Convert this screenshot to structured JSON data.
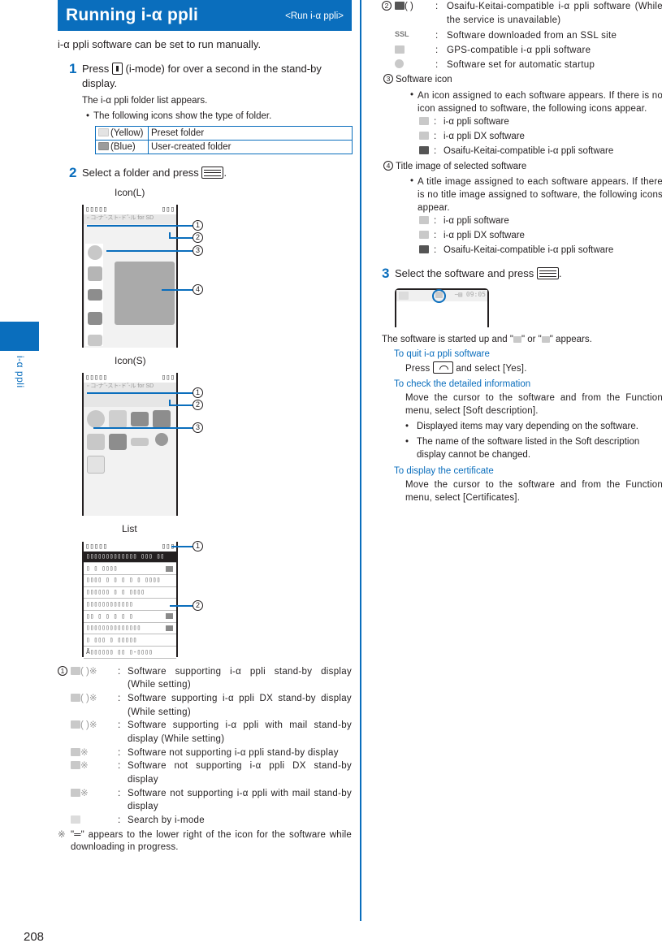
{
  "sidebar": {
    "section_label": "i-α ppli",
    "tab_color": "#0a6ebd"
  },
  "page_number": "208",
  "header": {
    "title": "Running i-α ppli",
    "subtitle": "<Run i-α ppli>"
  },
  "intro": "i-α ppli software can be set to run manually.",
  "step1": {
    "num": "1",
    "text_before": "Press",
    "key_icon": "i-mode-key",
    "text_after": "(i-mode) for over a second in the stand-by display.",
    "result": "The i-α ppli folder list appears.",
    "bullet": "The following icons show the type of folder.",
    "folder_table": [
      {
        "icon": "yellow-folder",
        "color_label": "(Yellow)",
        "desc": "Preset folder"
      },
      {
        "icon": "blue-folder",
        "color_label": "(Blue)",
        "desc": "User-created folder"
      }
    ]
  },
  "step2": {
    "num": "2",
    "text": "Select a folder and press",
    "key_icon": "menu-key",
    "screens": [
      {
        "label": "Icon(L)",
        "status_left": "▯▯▯▯▯",
        "status_right": "▯▯▯",
        "folder_bar": "▫ コ-ナ˝-スト-ド˝-ル for SD",
        "callouts": [
          "1",
          "2",
          "3",
          "4"
        ]
      },
      {
        "label": "Icon(S)",
        "status_left": "▯▯▯▯▯",
        "status_right": "▯▯▯",
        "folder_bar": "▫ コ-ナ˝-スト-ド˝-ル for SD",
        "callouts": [
          "1",
          "2",
          "3"
        ]
      },
      {
        "label": "List",
        "status_left": "▯▯▯▯▯",
        "status_right": "▯▯▯",
        "callouts": [
          "1",
          "2"
        ],
        "rows": [
          "▯▯▯▯▯▯▯▯▯▯▯▯▯ ▯▯▯ ▯▯",
          "▯ ▯ ▯▯▯▯",
          "▯▯▯▯ ▯ ▯ ▯ ▯ ▯ ▯▯▯▯",
          "▯▯▯▯▯▯ ▯ ▯ ▯▯▯▯",
          "▯▯▯▯▯▯▯▯▯▯▯▯",
          "▯▯  ▯ ▯ ▯ ▯ ▯",
          "▯▯▯▯▯▯▯▯▯▯▯▯▯▯",
          "▯ ▯▯▯ ▯ ▯▯▯▯▯",
          "Ā▯▯▯▯▯▯ ▯▯ ▯-▯▯▯▯"
        ]
      }
    ]
  },
  "legend1": {
    "marker": "1",
    "items": [
      {
        "icon": "i-appli-standby-icon",
        "icon_text": "(  )※",
        "desc": "Software supporting i-α ppli stand-by display (While setting)"
      },
      {
        "icon": "i-appli-dx-standby-icon",
        "icon_text": "(  )※",
        "desc": "Software supporting i-α ppli DX stand-by display (While setting)"
      },
      {
        "icon": "i-appli-mail-standby-icon",
        "icon_text": "(  )※",
        "desc": "Software supporting i-α ppli with mail stand-by display (While setting)"
      },
      {
        "icon": "i-appli-icon",
        "icon_text": "※",
        "desc": "Software not supporting i-α ppli stand-by display"
      },
      {
        "icon": "i-appli-dx-icon",
        "icon_text": "※",
        "desc": "Software not supporting i-α ppli DX stand-by display"
      },
      {
        "icon": "i-appli-mail-icon",
        "icon_text": "※",
        "desc": "Software not supporting i-α ppli with mail stand-by display"
      },
      {
        "icon": "i-mode-search-icon",
        "icon_text": "",
        "desc": "Search by i-mode"
      }
    ],
    "note_mark": "※",
    "note": "\"═\" appears to the lower right of the icon for the software while downloading in progress."
  },
  "legend2": {
    "marker": "2",
    "items": [
      {
        "icon": "osaifu-keitai-icon",
        "icon_text": "(  )",
        "desc": "Osaifu-Keitai-compatible i-α ppli software (While the service is unavailable)"
      },
      {
        "icon": "ssl-icon",
        "icon_text": "SSL",
        "desc": "Software downloaded from an SSL site"
      },
      {
        "icon": "gps-icon",
        "icon_text": "",
        "desc": "GPS-compatible i-α ppli software"
      },
      {
        "icon": "auto-start-icon",
        "icon_text": "",
        "desc": "Software set for automatic startup"
      }
    ]
  },
  "section3": {
    "marker": "3",
    "title": "Software icon",
    "bullet": "An icon assigned to each software appears. If there is no icon assigned to software, the following icons appear.",
    "icons": [
      {
        "icon": "i-appli-icon",
        "desc": "i-α ppli software"
      },
      {
        "icon": "i-appli-dx-icon",
        "desc": "i-α ppli DX software"
      },
      {
        "icon": "osaifu-keitai-icon",
        "desc": "Osaifu-Keitai-compatible i-α ppli software"
      }
    ]
  },
  "section4": {
    "marker": "4",
    "title": "Title image of selected software",
    "bullet": "A title image assigned to each software appears. If there is no title image assigned to software, the following icons appear.",
    "icons": [
      {
        "icon": "i-appli-icon",
        "desc": "i-α ppli software"
      },
      {
        "icon": "i-appli-dx-icon",
        "desc": "i-α ppli DX software"
      },
      {
        "icon": "osaifu-keitai-icon",
        "desc": "Osaifu-Keitai-compatible i-α ppli software"
      }
    ]
  },
  "step3": {
    "num": "3",
    "text": "Select the software and press",
    "key_icon": "menu-key",
    "screen_time": "−▤ 09:05",
    "result_before": "The software is started up and \"",
    "result_mid": "\" or \"",
    "result_after": "\" appears.",
    "tips": [
      {
        "heading": "To quit i-α ppli software",
        "body_before": "Press",
        "key_icon": "end-key",
        "body_after": "and select [Yes]."
      },
      {
        "heading": "To check the detailed information",
        "body": "Move the cursor to the software and from the Function menu, select [Soft description].",
        "bullets": [
          "Displayed items may vary depending on the software.",
          "The name of the software listed in the Soft description display cannot be changed."
        ]
      },
      {
        "heading": "To display the certificate",
        "body": "Move the cursor to the software and from the Function menu, select [Certificates]."
      }
    ]
  }
}
